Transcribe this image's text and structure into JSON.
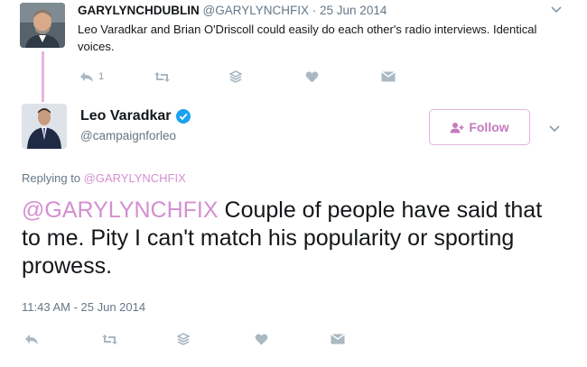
{
  "quoted_tweet": {
    "display_name": "GARYLYNCHDUBLIN",
    "handle": "@GARYLYNCHFIX",
    "date": "· 25 Jun 2014",
    "text": "Leo Varadkar and Brian O'Driscoll could easily do each other's radio interviews. Identical voices.",
    "reply_count": "1"
  },
  "main_tweet": {
    "display_name": "Leo Varadkar",
    "handle": "@campaignforleo",
    "follow_label": "Follow",
    "replying_prefix": "Replying to ",
    "replying_to": "@GARYLYNCHFIX",
    "mention": "@GARYLYNCHFIX",
    "text": " Couple of people have said that to me. Pity I can't match his popularity or sporting prowess.",
    "timestamp": "11:43 AM - 25 Jun 2014"
  },
  "colors": {
    "accent": "#d58fd0",
    "verified": "#1da1f2",
    "icon": "#aab8c2"
  },
  "icons": [
    "reply-icon",
    "retweet-icon",
    "stack-icon",
    "heart-icon",
    "message-icon",
    "verified-icon",
    "caret-down-icon",
    "follow-person-icon"
  ]
}
